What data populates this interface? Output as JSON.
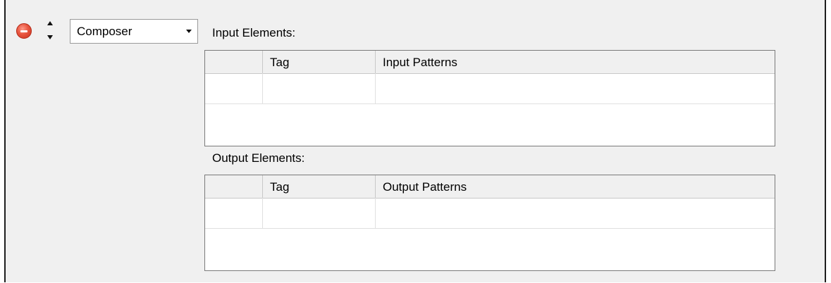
{
  "rule": {
    "remove_icon": "remove-circle-icon",
    "reorder_icon": "up-down-arrows-icon",
    "type_select": {
      "value": "Composer"
    }
  },
  "input_section": {
    "label": "Input Elements:",
    "columns": [
      "",
      "Tag",
      "Input Patterns"
    ],
    "rows": [
      [
        "",
        "",
        ""
      ]
    ]
  },
  "output_section": {
    "label": "Output Elements:",
    "columns": [
      "",
      "Tag",
      "Output Patterns"
    ],
    "rows": [
      [
        "",
        "",
        ""
      ]
    ]
  }
}
